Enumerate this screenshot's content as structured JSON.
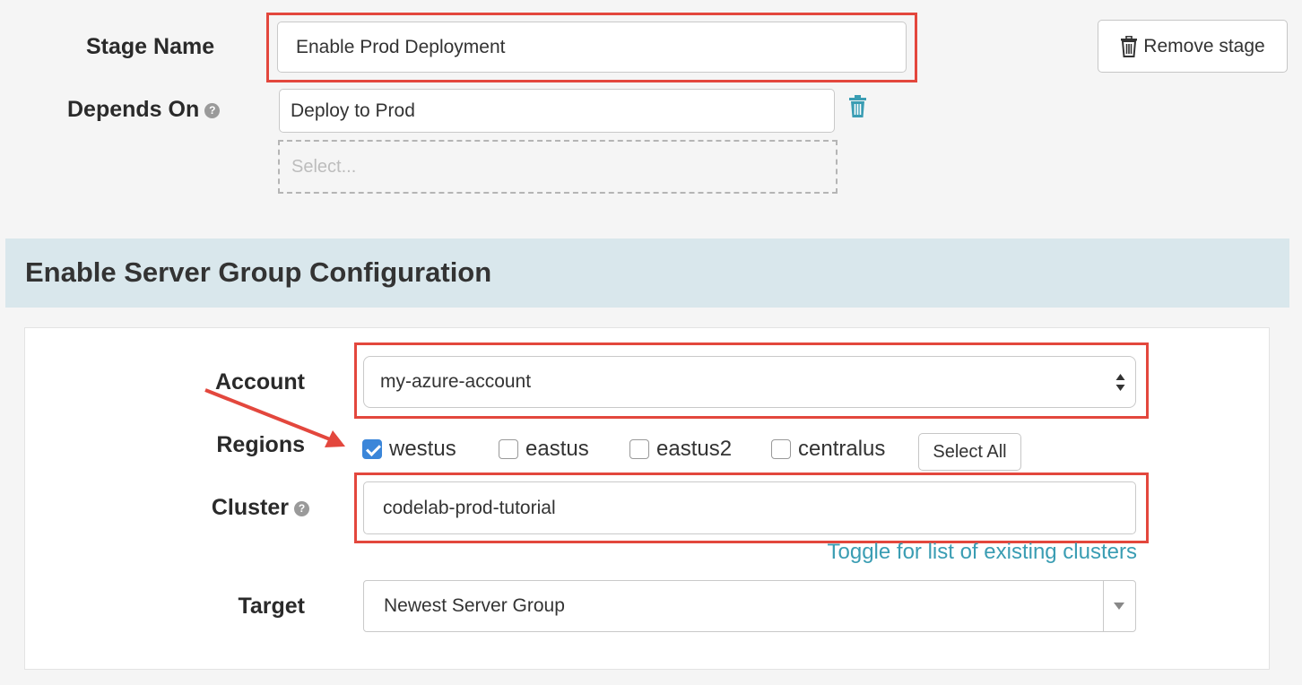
{
  "stage": {
    "name_label": "Stage Name",
    "name_value": "Enable Prod Deployment",
    "remove_label": "Remove stage",
    "depends_label": "Depends On",
    "depends_value": "Deploy to Prod",
    "depends_placeholder": "Select..."
  },
  "section": {
    "title": "Enable Server Group Configuration"
  },
  "form": {
    "account_label": "Account",
    "account_value": "my-azure-account",
    "regions_label": "Regions",
    "regions": [
      {
        "label": "westus",
        "checked": true
      },
      {
        "label": "eastus",
        "checked": false
      },
      {
        "label": "eastus2",
        "checked": false
      },
      {
        "label": "centralus",
        "checked": false
      }
    ],
    "select_all_label": "Select All",
    "cluster_label": "Cluster",
    "cluster_value": "codelab-prod-tutorial",
    "toggle_link": "Toggle for list of existing clusters",
    "target_label": "Target",
    "target_value": "Newest Server Group"
  },
  "colors": {
    "highlight": "#e3473d",
    "section_bg": "#d9e7ec",
    "link": "#3a9db3",
    "checkbox": "#3b86d9"
  }
}
